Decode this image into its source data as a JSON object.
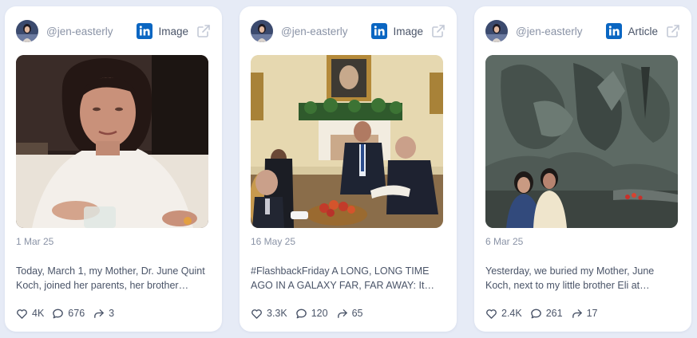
{
  "posts": [
    {
      "handle": "@jen-easterly",
      "network_icon": "linkedin-icon",
      "type": "Image",
      "date": "1 Mar 25",
      "text": "Today, March 1, my Mother, Dr. June Quint Koch, joined her parents, her brother…",
      "likes": "4K",
      "comments": "676",
      "shares": "3"
    },
    {
      "handle": "@jen-easterly",
      "network_icon": "linkedin-icon",
      "type": "Image",
      "date": "16 May 25",
      "text": "#FlashbackFriday A LONG, LONG TIME AGO IN A GALAXY FAR, FAR AWAY: It was…",
      "likes": "3.3K",
      "comments": "120",
      "shares": "65"
    },
    {
      "handle": "@jen-easterly",
      "network_icon": "linkedin-icon",
      "type": "Article",
      "date": "6 Mar 25",
      "text": "Yesterday, we buried my Mother, June Koch, next to my little brother Eli at…",
      "likes": "2.4K",
      "comments": "261",
      "shares": "17"
    }
  ],
  "colors": {
    "background": "#e6ebf6",
    "card": "#ffffff",
    "linkedin_blue": "#0a66c2",
    "muted_text": "#8a93a6",
    "body_text": "#4a5468"
  }
}
